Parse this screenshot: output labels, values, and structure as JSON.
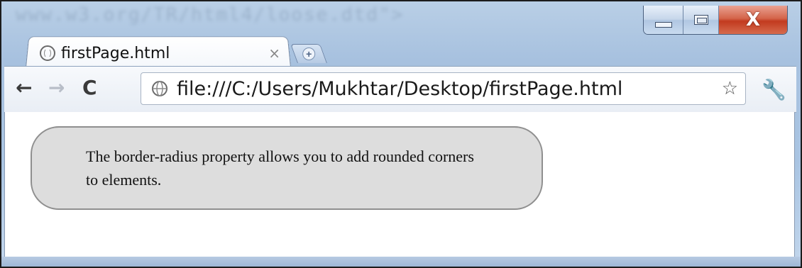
{
  "window": {
    "background_text": "www.w3.org/TR/html4/loose.dtd\">",
    "controls": {
      "close_glyph": "X"
    }
  },
  "tab": {
    "title": "firstPage.html",
    "close_glyph": "×",
    "new_tab_glyph": "+"
  },
  "toolbar": {
    "back_glyph": "←",
    "forward_glyph": "→",
    "reload_glyph": "C",
    "url": "file:///C:/Users/Mukhtar/Desktop/firstPage.html",
    "star_glyph": "☆",
    "wrench_glyph": "🔧"
  },
  "page": {
    "box_text": "The border-radius property allows you to add rounded corners to elements."
  },
  "icons": {
    "tab_icon": "globe-icon",
    "omnibox_icon": "globe-icon",
    "bookmark_icon": "star-icon",
    "menu_icon": "wrench-icon"
  },
  "colors": {
    "box_background": "#dddddd",
    "box_border": "#8f8f8f",
    "close_button": "#c94a2e",
    "frame": "#a9c4e2"
  }
}
